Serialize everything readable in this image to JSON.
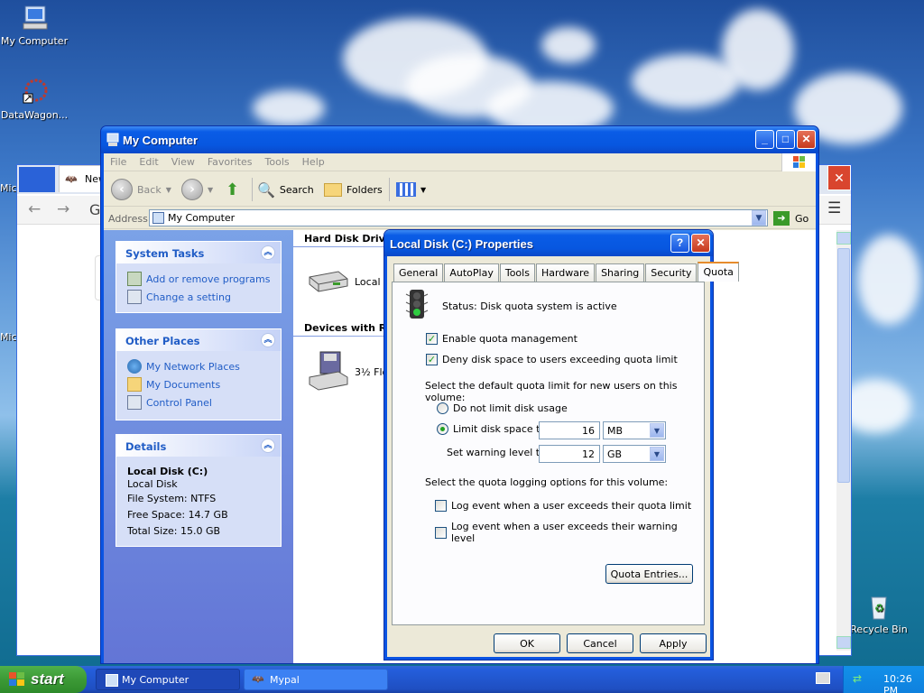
{
  "desktop": {
    "icons": [
      {
        "label": "My Computer"
      },
      {
        "label": "DataWagon..."
      },
      {
        "label": "Recycle Bin"
      }
    ],
    "partial_labels": [
      "Mic",
      "Mic"
    ]
  },
  "browser": {
    "tab_title": "New"
  },
  "explorer": {
    "title": "My Computer",
    "menu": [
      "File",
      "Edit",
      "View",
      "Favorites",
      "Tools",
      "Help"
    ],
    "toolbar": {
      "back": "Back",
      "search": "Search",
      "folders": "Folders"
    },
    "address": {
      "label": "Address",
      "value": "My Computer",
      "go": "Go"
    },
    "system_tasks": {
      "title": "System Tasks",
      "items": [
        "Add or remove programs",
        "Change a setting"
      ]
    },
    "other_places": {
      "title": "Other Places",
      "items": [
        "My Network Places",
        "My Documents",
        "Control Panel"
      ]
    },
    "details": {
      "title": "Details",
      "name": "Local Disk (C:)",
      "type": "Local Disk",
      "fs": "File System: NTFS",
      "free": "Free Space: 14.7 GB",
      "total": "Total Size: 15.0 GB"
    },
    "groups": {
      "hdd": "Hard Disk Drive",
      "devices": "Devices with Re"
    },
    "items": {
      "local": "Local D",
      "floppy": "3½ Flo"
    }
  },
  "dialog": {
    "title": "Local Disk (C:) Properties",
    "tabs": [
      "General",
      "AutoPlay",
      "Tools",
      "Hardware",
      "Sharing",
      "Security",
      "Quota"
    ],
    "status": "Status:  Disk quota system is active",
    "enable": "Enable quota management",
    "deny": "Deny disk space to users exceeding quota limit",
    "select_default": "Select the default quota limit for new users on this volume:",
    "no_limit": "Do not limit disk usage",
    "limit": "Limit disk space to",
    "limit_value": "16",
    "limit_unit": "MB",
    "warning": "Set warning level to",
    "warning_value": "12",
    "warning_unit": "GB",
    "logging": "Select the quota logging options for this volume:",
    "log_quota": "Log event when a user exceeds their quota limit",
    "log_warning": "Log event when a user exceeds their warning level",
    "entries": "Quota Entries...",
    "ok": "OK",
    "cancel": "Cancel",
    "apply": "Apply"
  },
  "taskbar": {
    "start": "start",
    "tasks": [
      "My Computer",
      "Mypal"
    ],
    "clock": "10:26 PM"
  }
}
